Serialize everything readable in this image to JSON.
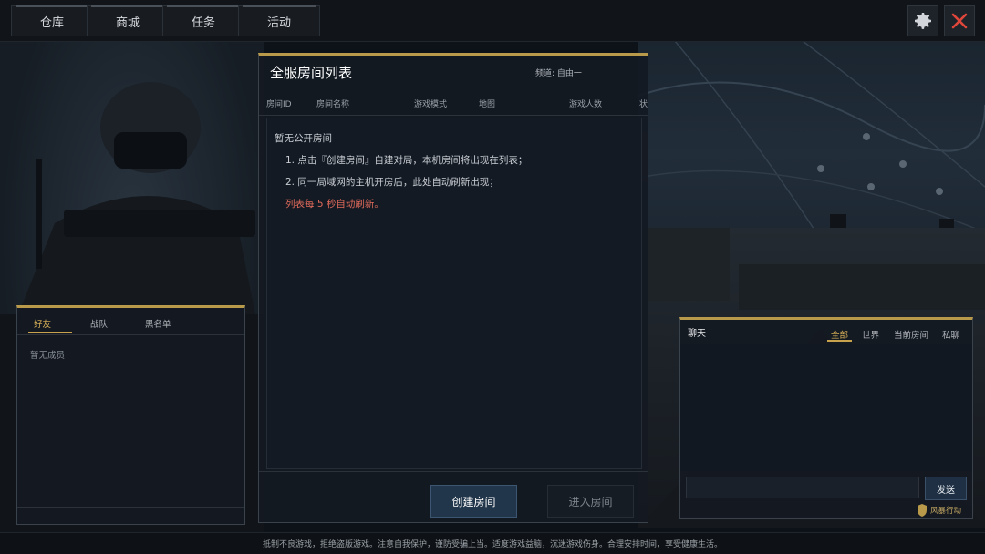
{
  "nav": {
    "tabs": [
      "仓库",
      "商城",
      "任务",
      "活动"
    ],
    "settings_icon": "gear-icon",
    "close_icon": "close-icon"
  },
  "room_list": {
    "title": "全服房间列表",
    "channel": "频道: 自由一",
    "columns": [
      "房间ID",
      "房间名称",
      "游戏模式",
      "地图",
      "游戏人数",
      "状态"
    ],
    "empty_title": "暂无公开房间",
    "tips": [
      "1. 点击『创建房间』自建对局，本机房间将出现在列表；",
      "2. 同一局域网的主机开房后，此处自动刷新出现；"
    ],
    "refresh_note": "列表每 5 秒自动刷新。",
    "create_button": "创建房间",
    "join_button": "进入房间"
  },
  "friends": {
    "tabs": [
      "好友",
      "战队",
      "黑名单"
    ],
    "active_tab": "好友",
    "empty_text": "暂无成员"
  },
  "chat": {
    "title": "聊天",
    "tabs": [
      "全部",
      "世界",
      "当前房间",
      "私聊"
    ],
    "active_tab": "全部",
    "send_button": "发送",
    "brand": "风暴行动"
  },
  "footer": {
    "notice": "抵制不良游戏，拒绝盗版游戏。注意自我保护，谨防受骗上当。适度游戏益脑，沉迷游戏伤身。合理安排时间，享受健康生活。"
  },
  "colors": {
    "accent_gold": "#c9a24e",
    "close_red": "#e0463a",
    "note_red": "#e06a5a"
  }
}
